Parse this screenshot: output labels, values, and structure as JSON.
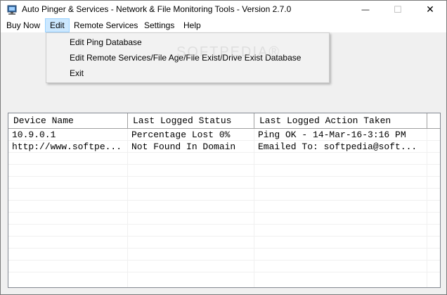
{
  "window": {
    "title": "Auto Pinger & Services - Network & File Monitoring Tools - Version 2.7.0",
    "minimize_glyph": "—",
    "maximize_glyph": "☐",
    "close_glyph": "✕"
  },
  "menubar": {
    "items": [
      "Buy Now",
      "Edit",
      "Remote Services",
      "Settings",
      "Help"
    ],
    "active": "Edit"
  },
  "edit_menu": {
    "items": [
      "Edit Ping Database",
      "Edit Remote Services/File Age/File Exist/Drive Exist Database",
      "Exit"
    ]
  },
  "watermark": "SOFTPEDIA®",
  "table": {
    "columns": [
      "Device Name",
      "Last Logged Status",
      "Last Logged Action Taken"
    ],
    "rows": [
      [
        "10.9.0.1",
        "Percentage Lost 0%",
        "Ping OK - 14-Mar-16-3:16 PM"
      ],
      [
        "http://www.softpe...",
        "Not Found In Domain",
        "Emailed To: softpedia@soft..."
      ]
    ]
  },
  "colors": {
    "menu_highlight": "#cce8ff",
    "menu_highlight_border": "#99d1ff",
    "window_bg": "#f0f0f0",
    "list_border": "#828790"
  },
  "icons": {
    "app": "app-network-icon"
  }
}
